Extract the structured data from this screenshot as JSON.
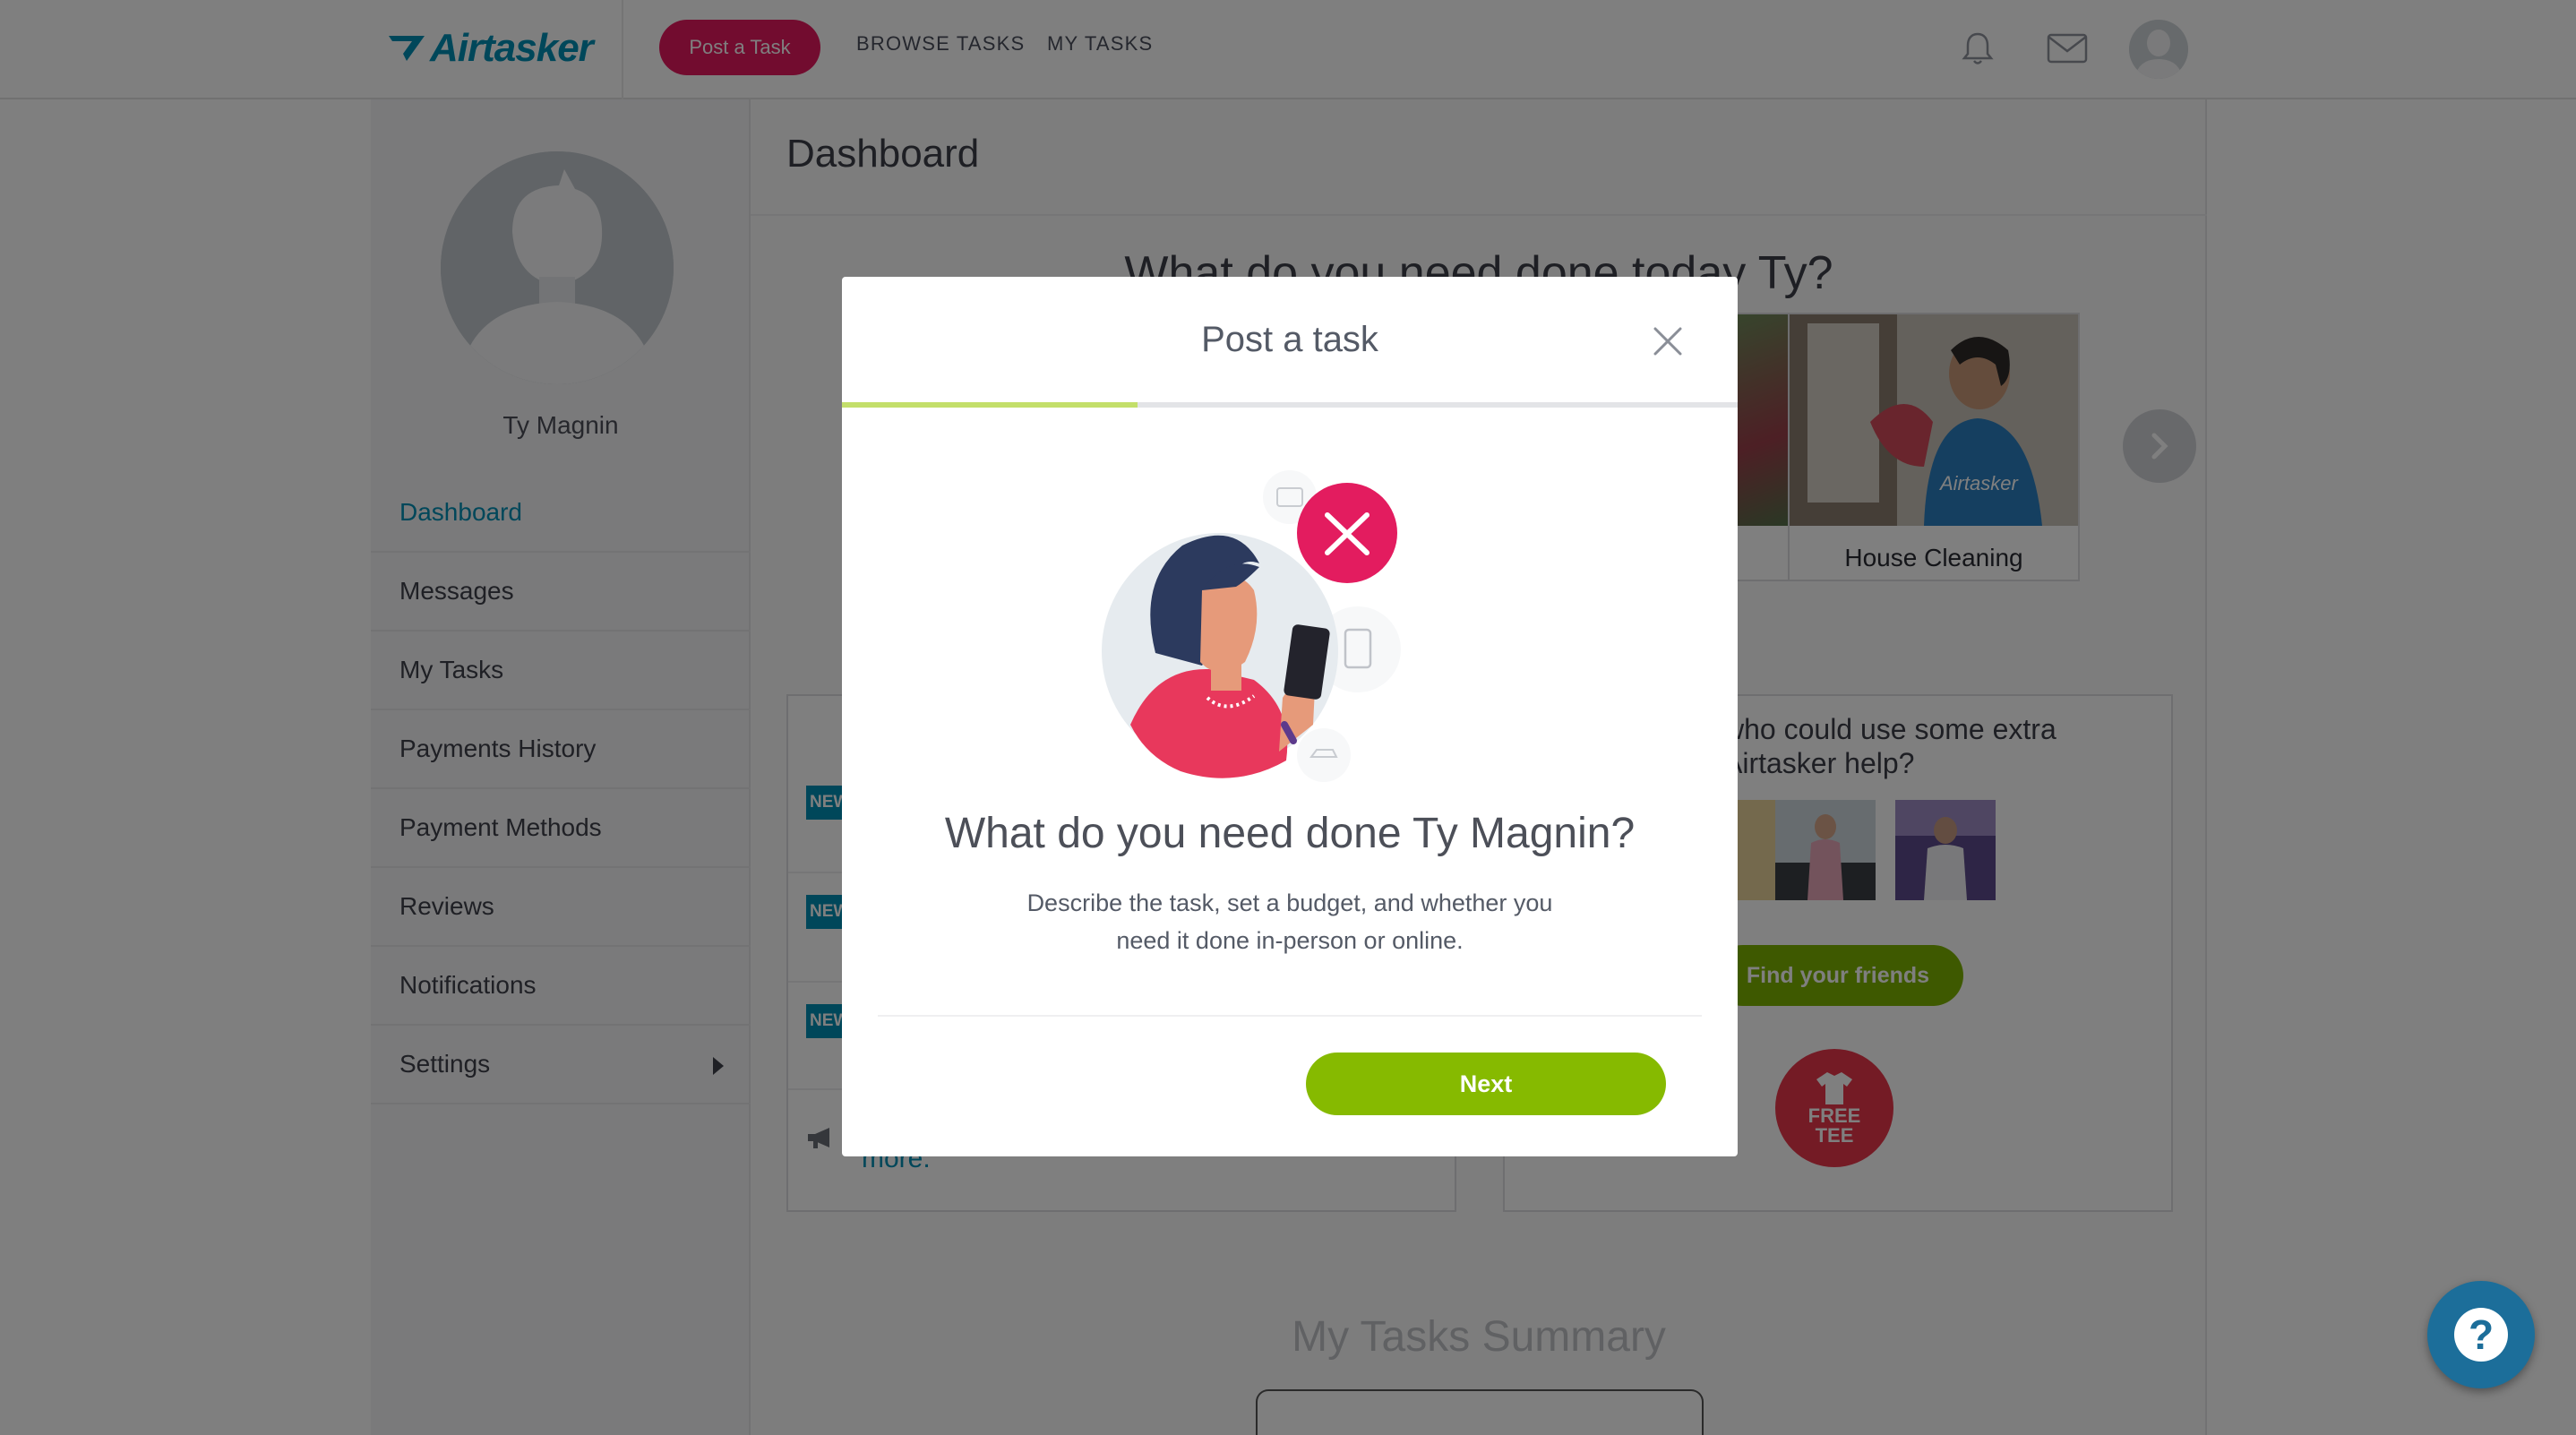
{
  "header": {
    "logo_text": "Airtasker",
    "post_task_label": "Post a Task",
    "nav": [
      "BROWSE TASKS",
      "MY TASKS"
    ],
    "icons": [
      "bell-icon",
      "mail-icon",
      "avatar"
    ]
  },
  "sidebar": {
    "user_name": "Ty Magnin",
    "items": [
      {
        "label": "Dashboard",
        "active": true
      },
      {
        "label": "Messages"
      },
      {
        "label": "My Tasks"
      },
      {
        "label": "Payments History"
      },
      {
        "label": "Payment Methods"
      },
      {
        "label": "Reviews"
      },
      {
        "label": "Notifications"
      },
      {
        "label": "Settings",
        "has_submenu": true
      }
    ]
  },
  "main": {
    "title": "Dashboard",
    "hero_question": "What do you need done today Ty?",
    "category_card_label": "House Cleaning",
    "news_badge": "NEW",
    "more_link": "more.",
    "refer_text": "who could use some extra Airtasker help?",
    "find_friends_label": "Find your friends",
    "free_tee": [
      "FREE",
      "TEE"
    ],
    "summary_title": "My Tasks Summary"
  },
  "modal": {
    "title": "Post a task",
    "progress": 0.33,
    "heading": "What do you need done Ty Magnin?",
    "description": "Describe the task, set a budget, and whether you need it done in-person or online.",
    "next_label": "Next"
  },
  "colors": {
    "brand_blue": "#008fb4",
    "post_task_pink": "#e5195f",
    "next_green": "#86ba00",
    "progress_green": "#c3df6a",
    "help_blue": "#1c6e9a"
  }
}
